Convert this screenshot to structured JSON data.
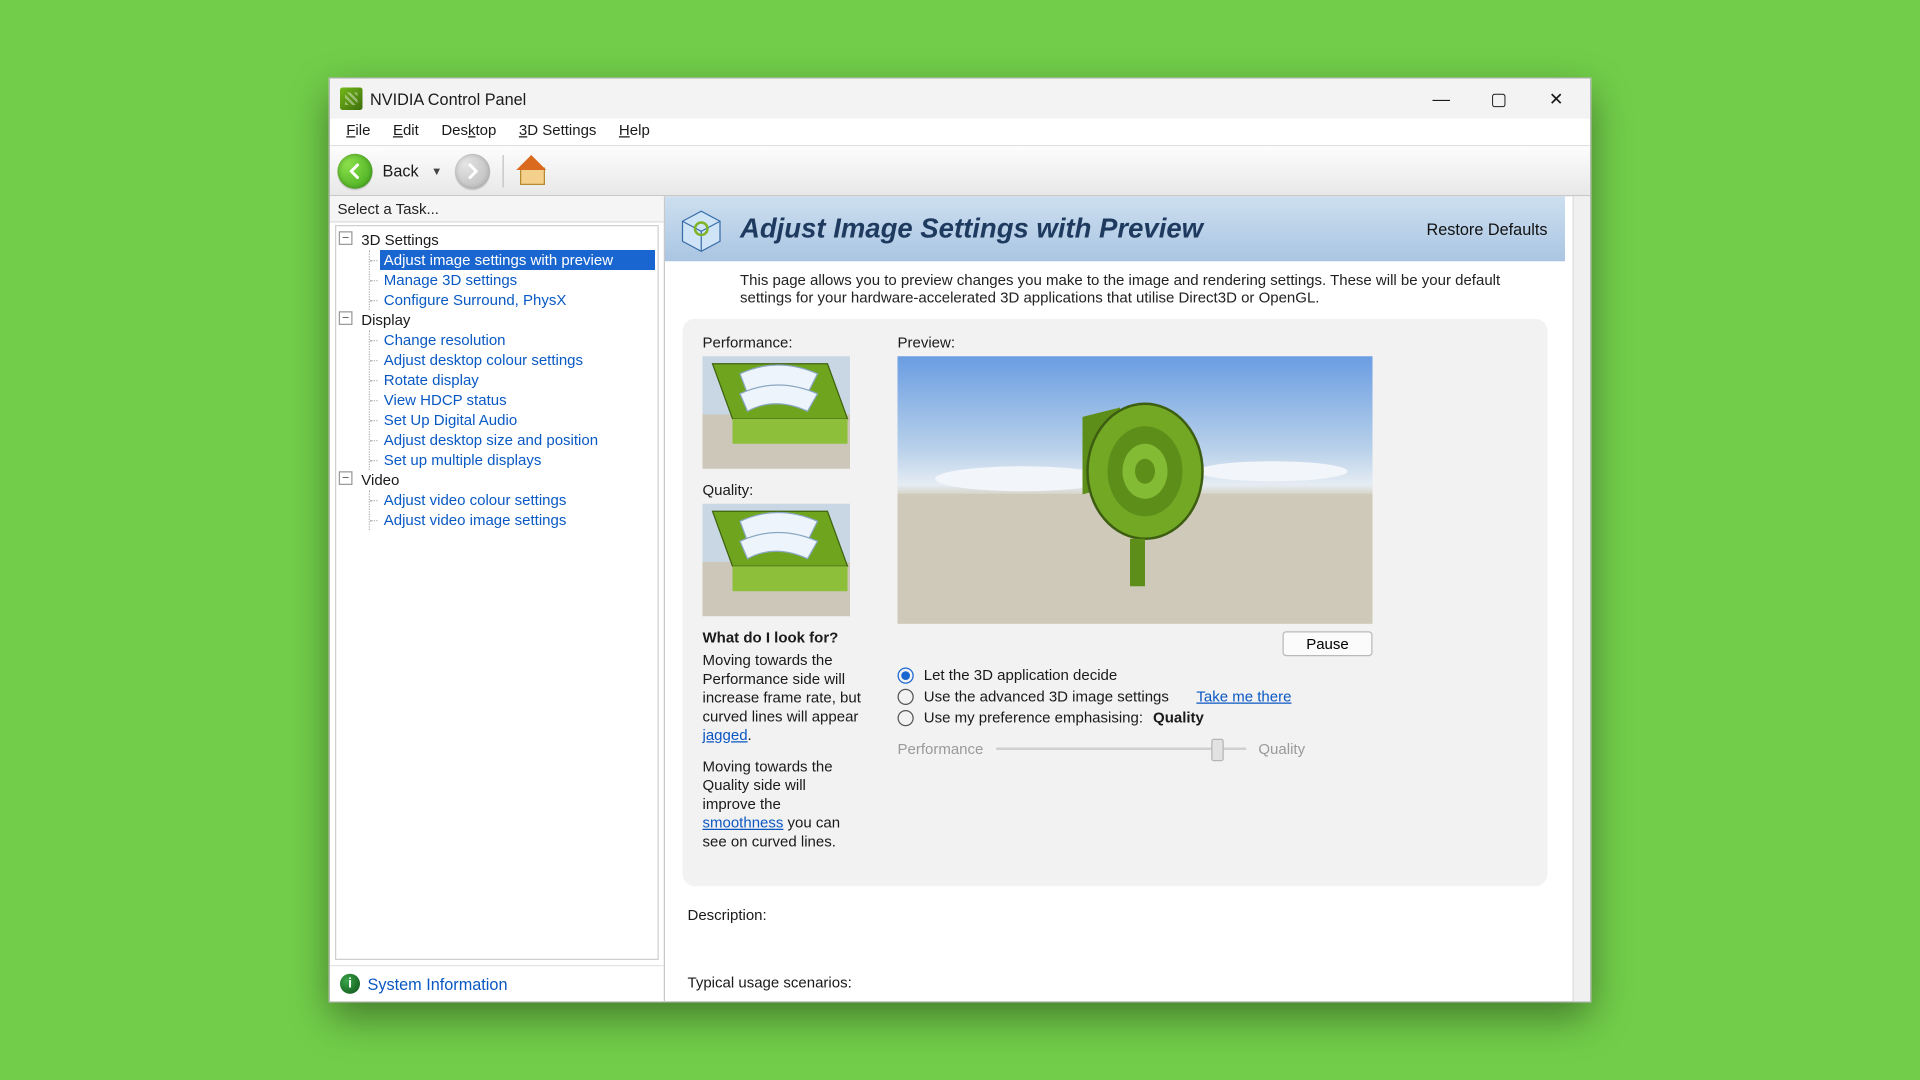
{
  "titlebar": {
    "title": "NVIDIA Control Panel"
  },
  "menu": [
    "File",
    "Edit",
    "Desktop",
    "3D Settings",
    "Help"
  ],
  "menu_ul": [
    "F",
    "E",
    "k",
    "3",
    "H"
  ],
  "toolbar": {
    "back": "Back"
  },
  "sidebar": {
    "task_header": "Select a Task...",
    "groups": [
      {
        "label": "3D Settings",
        "items": [
          "Adjust image settings with preview",
          "Manage 3D settings",
          "Configure Surround, PhysX"
        ],
        "active_index": 0
      },
      {
        "label": "Display",
        "items": [
          "Change resolution",
          "Adjust desktop colour settings",
          "Rotate display",
          "View HDCP status",
          "Set Up Digital Audio",
          "Adjust desktop size and position",
          "Set up multiple displays"
        ]
      },
      {
        "label": "Video",
        "items": [
          "Adjust video colour settings",
          "Adjust video image settings"
        ]
      }
    ],
    "system_information": "System Information"
  },
  "header": {
    "title": "Adjust Image Settings with Preview",
    "restore": "Restore Defaults"
  },
  "intro": "This page allows you to preview changes you make to the image and rendering settings. These will be your default settings for your hardware-accelerated 3D applications that utilise Direct3D or OpenGL.",
  "left": {
    "performance": "Performance:",
    "quality": "Quality:",
    "what": "What do I look for?",
    "p1a": "Moving towards the Performance side will increase frame rate, but curved lines will appear ",
    "p1_link": "jagged",
    "p1b": ".",
    "p2a": "Moving towards the Quality side will improve the ",
    "p2_link": "smoothness",
    "p2b": " you can see on curved lines."
  },
  "right": {
    "preview": "Preview:",
    "pause": "Pause",
    "opt1": "Let the 3D application decide",
    "opt2": "Use the advanced 3D image settings",
    "take_me": "Take me there",
    "opt3": "Use my preference emphasising:",
    "opt3_value": "Quality",
    "slider_left": "Performance",
    "slider_right": "Quality"
  },
  "bottom": {
    "description": "Description:",
    "typical": "Typical usage scenarios:"
  }
}
